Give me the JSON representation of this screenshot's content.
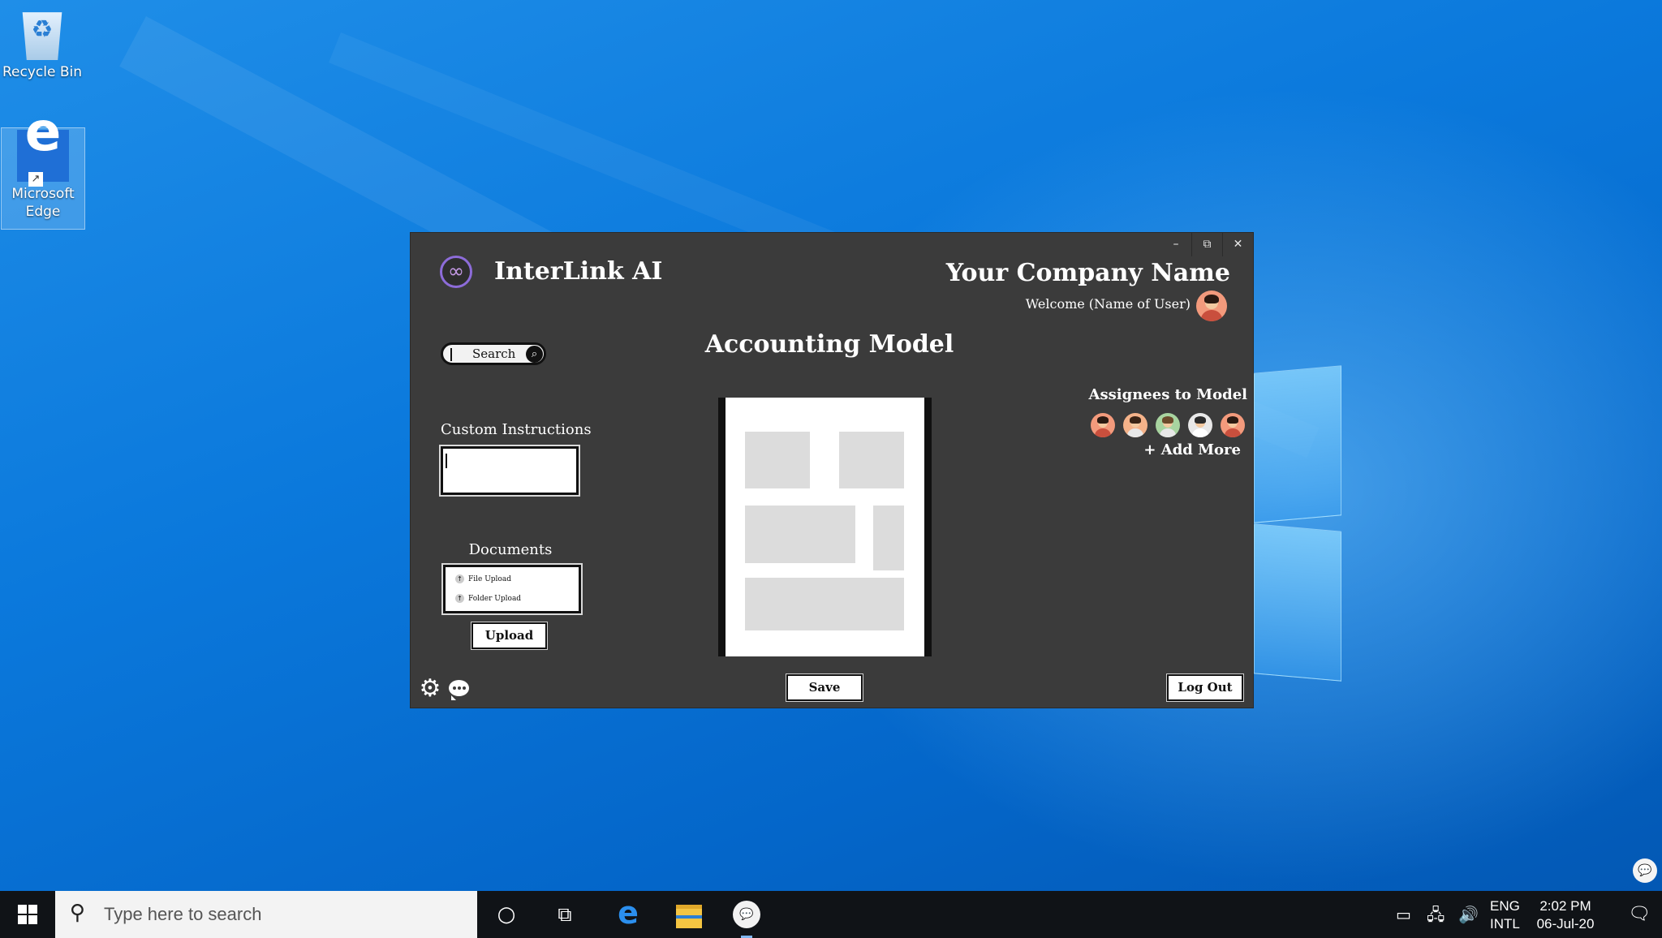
{
  "desktop": {
    "icons": [
      {
        "label": "Recycle Bin"
      },
      {
        "label": "Microsoft Edge"
      }
    ]
  },
  "window": {
    "controls": {
      "minimize": "–",
      "restore": "⧉",
      "close": "✕"
    },
    "brand": {
      "logo_glyph": "∞",
      "name": "InterLink AI"
    },
    "company_name": "Your Company Name",
    "welcome": "Welcome (Name of User)",
    "search": {
      "label": "Search",
      "icon": "search-icon"
    },
    "page_title": "Accounting Model",
    "custom_instructions": {
      "label": "Custom Instructions",
      "value": ""
    },
    "documents": {
      "label": "Documents",
      "items": [
        "File Upload",
        "Folder Upload"
      ],
      "upload_label": "Upload"
    },
    "assignees": {
      "label": "Assignees to Model",
      "add_more": "+ Add More",
      "avatars": [
        {
          "bg": "#f39a7c",
          "hair": "#2b1a12",
          "shirt": "#c94f3d"
        },
        {
          "bg": "#f5b38a",
          "hair": "#3a2416",
          "shirt": "#e8e8e8"
        },
        {
          "bg": "#a8d4a0",
          "hair": "#6b4a2b",
          "shirt": "#e8e8e8"
        },
        {
          "bg": "#e8e8e8",
          "hair": "#2b2b2b",
          "shirt": "#ffffff"
        },
        {
          "bg": "#f39a7c",
          "hair": "#2b1a12",
          "shirt": "#c94f3d"
        }
      ]
    },
    "save_label": "Save",
    "logout_label": "Log Out",
    "accent": "#8d6cd9",
    "panel_bg": "#3b3b3b"
  },
  "taskbar": {
    "search_placeholder": "Type here to search",
    "lang_line1": "ENG",
    "lang_line2": "INTL",
    "time": "2:02 PM",
    "date": "06-Jul-20"
  }
}
